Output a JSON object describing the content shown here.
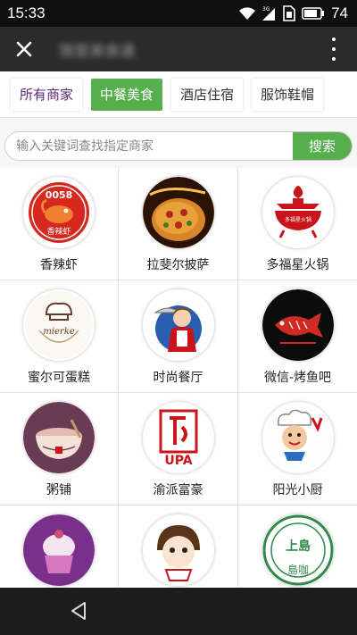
{
  "status": {
    "time": "15:33",
    "battery": "74"
  },
  "app": {
    "title": "锦里美食通"
  },
  "tabs": [
    {
      "label": "所有商家"
    },
    {
      "label": "中餐美食"
    },
    {
      "label": "酒店住宿"
    },
    {
      "label": "服饰鞋帽"
    }
  ],
  "search": {
    "placeholder": "输入关键词查找指定商家",
    "button": "搜索"
  },
  "merchants": [
    {
      "name": "香辣虾"
    },
    {
      "name": "拉斐尔披萨"
    },
    {
      "name": "多福星火锅"
    },
    {
      "name": "蜜尔可蛋糕"
    },
    {
      "name": "时尚餐厅"
    },
    {
      "name": "微信-烤鱼吧"
    },
    {
      "name": "粥铺"
    },
    {
      "name": "渝派富豪"
    },
    {
      "name": "阳光小厨"
    },
    {
      "name": ""
    },
    {
      "name": ""
    },
    {
      "name": ""
    }
  ],
  "logos": {
    "shrimp": {
      "top_text": "0058",
      "bottom_text": "香辣虾"
    },
    "hotpot": {
      "text": "多福星火锅"
    },
    "cake": {
      "text": "mierke"
    },
    "yupai": {
      "text": "UPA"
    },
    "shangdao": {
      "text": "上島",
      "sub": "島咖"
    }
  },
  "colors": {
    "accent": "#56ae4c",
    "header": "#2b2b2b",
    "statusbar": "#0f0f0f"
  }
}
